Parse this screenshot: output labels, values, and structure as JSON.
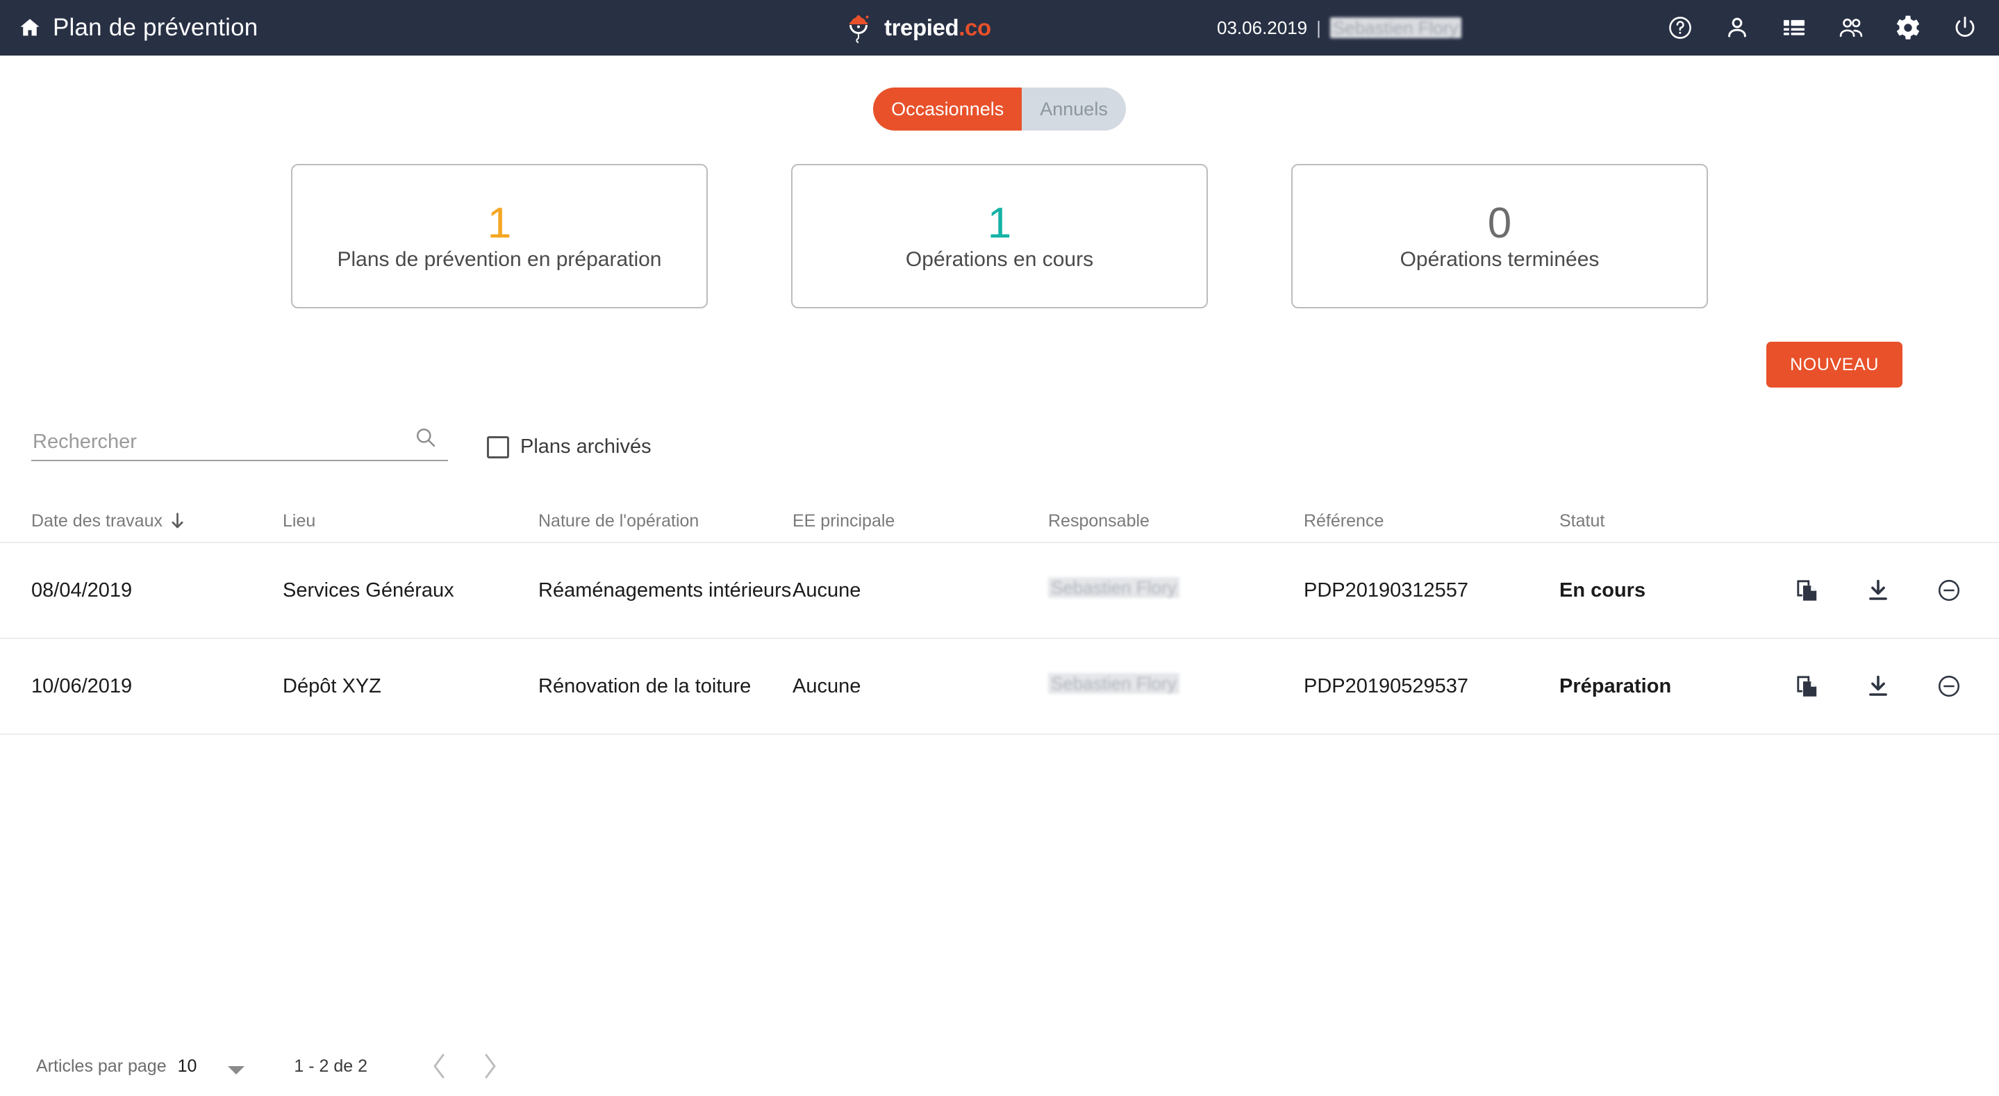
{
  "header": {
    "home_icon": "home-icon",
    "title": "Plan de prévention",
    "logo": {
      "name_white": "trepied",
      "name_orange": ".co",
      "mark": "hardhat-crane-icon"
    },
    "date": "03.06.2019",
    "separator": "|",
    "user": "Sebastien Flory",
    "icons": [
      "help-circle-icon",
      "person-icon",
      "list-icon",
      "people-icon",
      "gear-icon",
      "power-icon"
    ]
  },
  "segmented": {
    "occasionnels": "Occasionnels",
    "annuels": "Annuels",
    "active": "Occasionnels"
  },
  "cards": [
    {
      "value": "1",
      "label": "Plans de prévention en préparation",
      "color": "#F5A623"
    },
    {
      "value": "1",
      "label": "Opérations en cours",
      "color": "#14b3a6"
    },
    {
      "value": "0",
      "label": "Opérations terminées",
      "color": "#6d6d6d"
    }
  ],
  "actions": {
    "new_label": "NOUVEAU"
  },
  "search": {
    "placeholder": "Rechercher",
    "value": "",
    "icon": "search-icon",
    "archived_label": "Plans archivés",
    "archived_checked": false
  },
  "table": {
    "columns": [
      "Date des travaux",
      "Lieu",
      "Nature de l'opération",
      "EE principale",
      "Responsable",
      "Référence",
      "Statut"
    ],
    "sort": {
      "column": "Date des travaux",
      "direction": "desc",
      "icon": "arrow-down-icon"
    },
    "row_icons": [
      "duplicate-icon",
      "download-icon",
      "minus-circle-icon"
    ],
    "rows": [
      {
        "date": "08/04/2019",
        "lieu": "Services Généraux",
        "nature": "Réaménagements intérieurs",
        "ee": "Aucune",
        "responsable": "Sebastien Flory",
        "reference": "PDP20190312557",
        "statut": "En cours",
        "statut_color": "#14b3a6"
      },
      {
        "date": "10/06/2019",
        "lieu": "Dépôt XYZ",
        "nature": "Rénovation de la toiture",
        "ee": "Aucune",
        "responsable": "Sebastien Flory",
        "reference": "PDP20190529537",
        "statut": "Préparation",
        "statut_color": "#F5A623"
      }
    ]
  },
  "pagination": {
    "items_per_page_label": "Articles par page",
    "items_per_page_value": "10",
    "range": "1 - 2 de 2",
    "prev_icon": "chevron-left-icon",
    "next_icon": "chevron-right-icon"
  },
  "theme": {
    "header_bg": "#283044",
    "accent": "#E8512A",
    "teal": "#14b3a6",
    "amber": "#F5A623"
  }
}
